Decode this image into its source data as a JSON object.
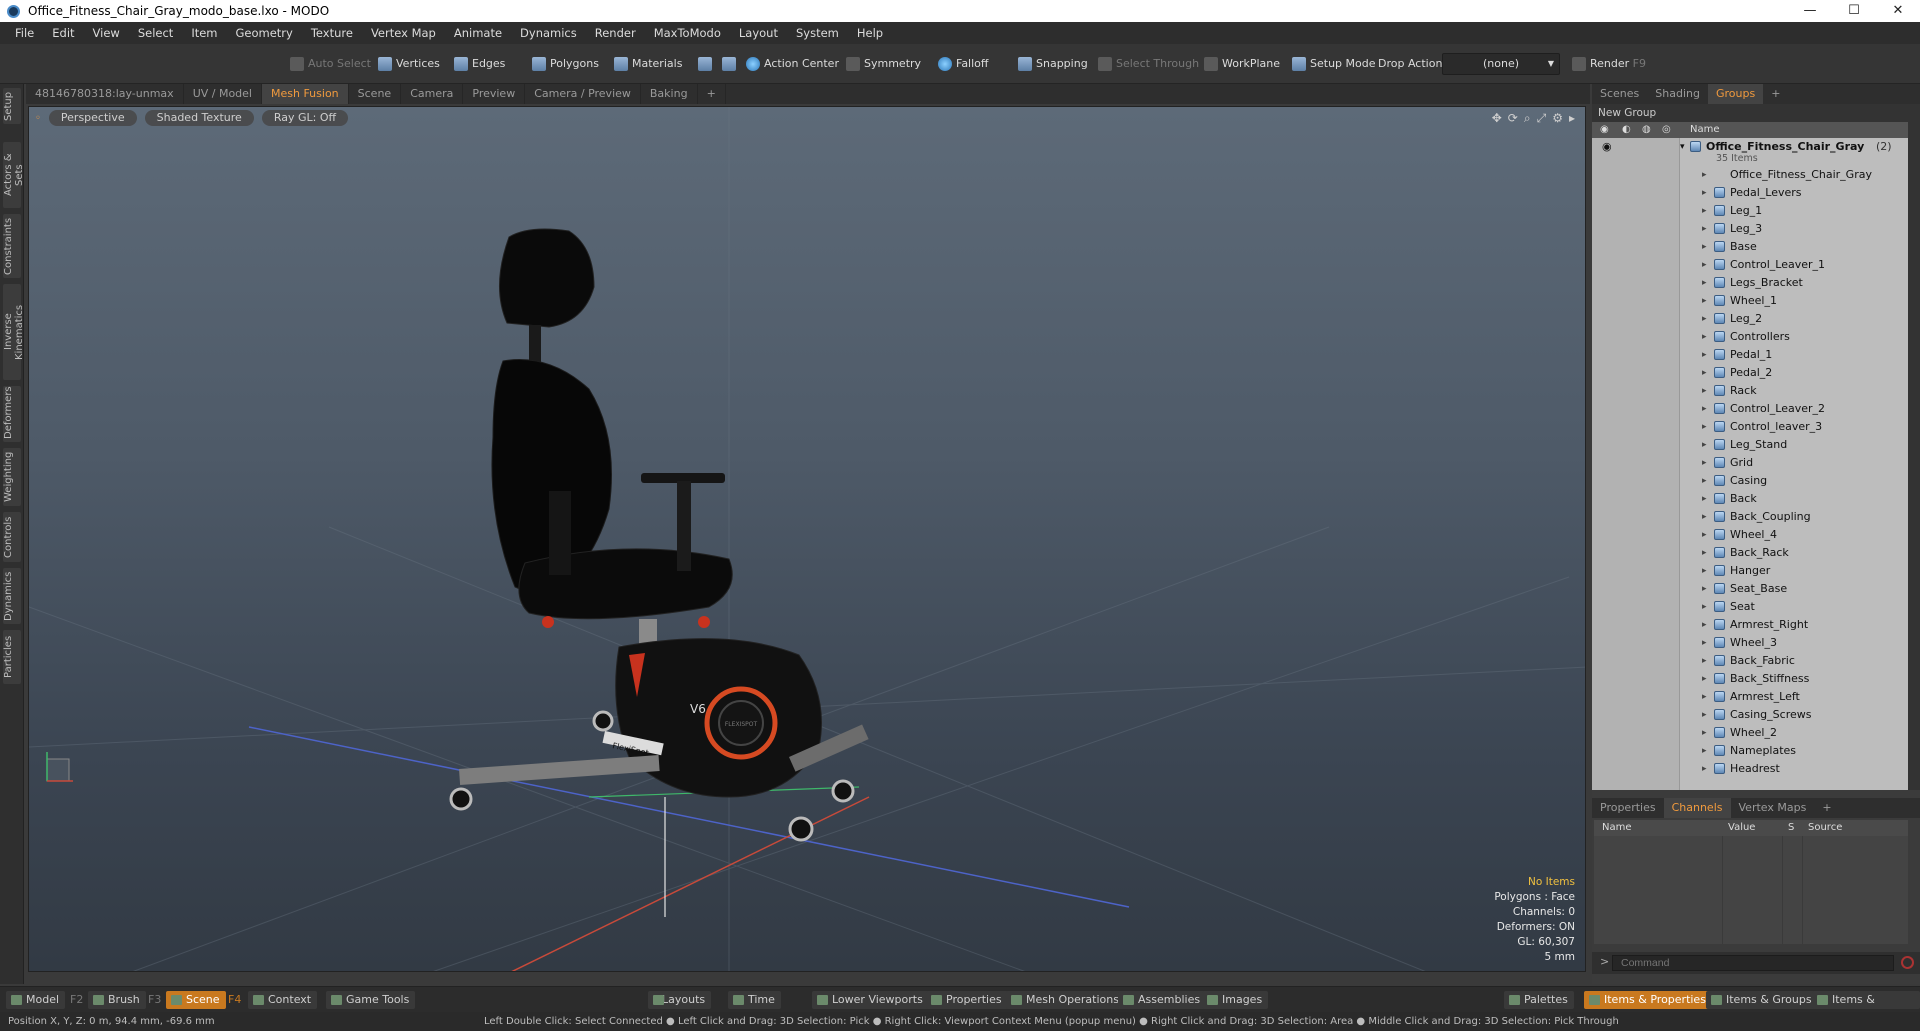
{
  "window": {
    "title": "Office_Fitness_Chair_Gray_modo_base.lxo - MODO",
    "minimize": "—",
    "maximize": "☐",
    "close": "✕"
  },
  "menu": [
    "File",
    "Edit",
    "View",
    "Select",
    "Item",
    "Geometry",
    "Texture",
    "Vertex Map",
    "Animate",
    "Dynamics",
    "Render",
    "MaxToModo",
    "Layout",
    "System",
    "Help"
  ],
  "toolbar": {
    "auto_select": "Auto Select",
    "vertices": "Vertices",
    "edges": "Edges",
    "polygons": "Polygons",
    "materials": "Materials",
    "action_center": "Action Center",
    "symmetry": "Symmetry",
    "falloff": "Falloff",
    "snapping": "Snapping",
    "select_through": "Select Through",
    "workplane": "WorkPlane",
    "setup_mode": "Setup Mode",
    "drop_action": "Drop Action",
    "drop_value": "(none)",
    "render": "Render",
    "render_key": "F9"
  },
  "left_tabs": [
    "Setup",
    "Actors & Sets",
    "Constraints",
    "Inverse Kinematics",
    "Deformers",
    "Weighting",
    "Controls",
    "Dynamics",
    "Particles"
  ],
  "viewport_tabs": [
    "48146780318:lay-unmax",
    "UV / Model",
    "Mesh Fusion",
    "Scene",
    "Camera",
    "Preview",
    "Camera / Preview",
    "Baking",
    "+"
  ],
  "viewport": {
    "perspective": "Perspective",
    "shading": "Shaded Texture",
    "raygl": "Ray GL: Off",
    "nameplate": "FlexiSpot",
    "side_logo": "V6",
    "dial": "FLEXISPOT"
  },
  "stats": {
    "items": "No Items",
    "polygons": "Polygons : Face",
    "channels": "Channels: 0",
    "deformers": "Deformers: ON",
    "gl": "GL: 60,307",
    "scale": "5 mm"
  },
  "right_tabs": [
    "Scenes",
    "Shading",
    "Groups",
    "+"
  ],
  "groups": {
    "new_group": "New Group",
    "name_header": "Name",
    "root": "Office_Fitness_Chair_Gray",
    "root_count": "(2)",
    "root_items": "35 Items",
    "items": [
      "Office_Fitness_Chair_Gray",
      "Pedal_Levers",
      "Leg_1",
      "Leg_3",
      "Base",
      "Control_Leaver_1",
      "Legs_Bracket",
      "Wheel_1",
      "Leg_2",
      "Controllers",
      "Pedal_1",
      "Pedal_2",
      "Rack",
      "Control_Leaver_2",
      "Control_leaver_3",
      "Leg_Stand",
      "Grid",
      "Casing",
      "Back",
      "Back_Coupling",
      "Wheel_4",
      "Back_Rack",
      "Hanger",
      "Seat_Base",
      "Seat",
      "Armrest_Right",
      "Wheel_3",
      "Back_Fabric",
      "Back_Stiffness",
      "Armrest_Left",
      "Casing_Screws",
      "Wheel_2",
      "Nameplates",
      "Headrest"
    ]
  },
  "props_tabs": [
    "Properties",
    "Channels",
    "Vertex Maps",
    "+"
  ],
  "channels": {
    "name": "Name",
    "value": "Value",
    "s": "S",
    "source": "Source"
  },
  "command": {
    "prompt": ">",
    "placeholder": "Command"
  },
  "bottom": {
    "model": "Model",
    "model_key": "F2",
    "brush": "Brush",
    "brush_key": "F3",
    "scene": "Scene",
    "scene_key": "F4",
    "context": "Context",
    "game_tools": "Game Tools",
    "layouts": "Layouts",
    "time": "Time",
    "lower_viewports": "Lower Viewports",
    "properties": "Properties",
    "mesh_operations": "Mesh Operations",
    "assemblies": "Assemblies",
    "images": "Images",
    "palettes": "Palettes",
    "items_properties": "Items & Properties",
    "items_groups": "Items & Groups",
    "items_shading": "Items & Shading"
  },
  "status": {
    "position": "Position X, Y, Z:  0 m, 94.4 mm, -69.6 mm",
    "hint": "Left Double Click: Select Connected ● Left Click and Drag: 3D Selection: Pick ● Right Click: Viewport Context Menu (popup menu) ● Right Click and Drag: 3D Selection: Area ● Middle Click and Drag: 3D Selection: Pick Through"
  }
}
